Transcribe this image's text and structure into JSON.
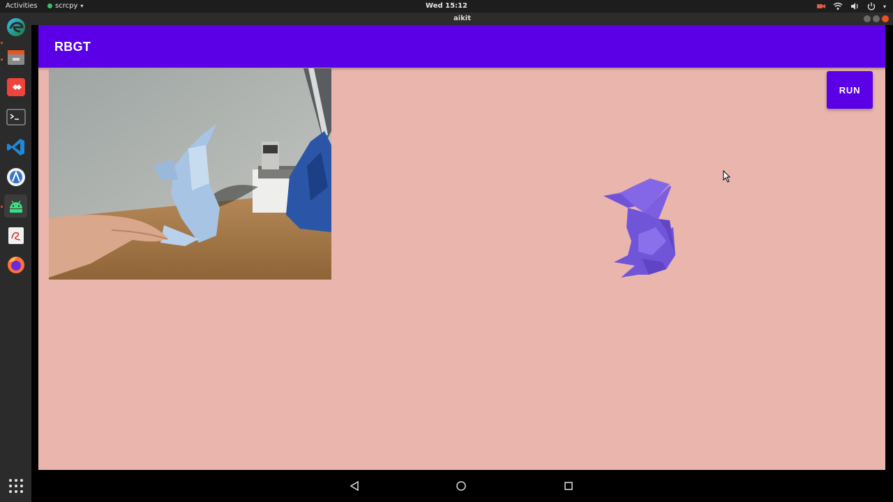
{
  "topbar": {
    "activities": "Activities",
    "app_name": "scrcpy",
    "clock": "Wed 15:12"
  },
  "window": {
    "title": "aikit"
  },
  "dock": {
    "items": [
      "edge-icon",
      "files-icon",
      "anydesk-icon",
      "terminal-icon",
      "vscode-icon",
      "android-studio-icon",
      "android-icon",
      "libreoffice-icon",
      "firefox-icon"
    ],
    "show_apps": "app-grid-icon"
  },
  "app": {
    "title": "RBGT",
    "run_label": "RUN",
    "primary_color": "#5b00e6",
    "background_color": "#e9b5ad"
  },
  "navbar": {
    "buttons": [
      "back-icon",
      "home-icon",
      "recents-icon"
    ]
  }
}
